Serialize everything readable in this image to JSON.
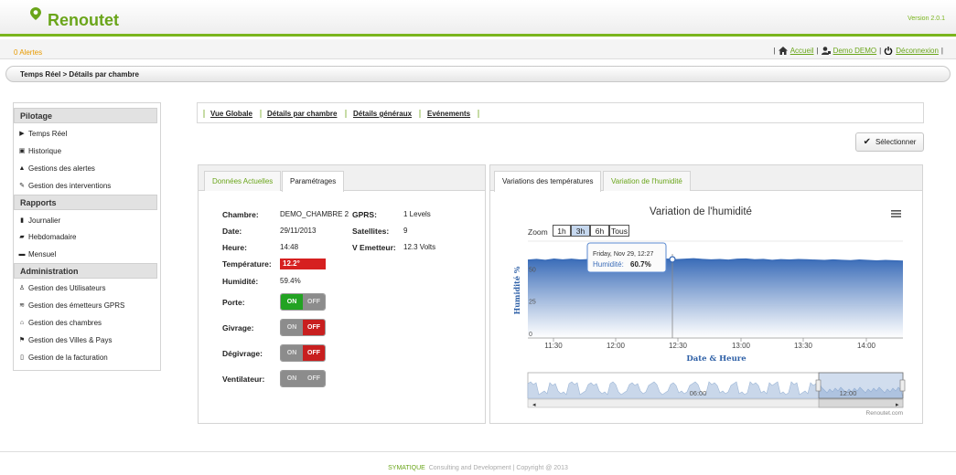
{
  "header": {
    "logo_text": "Renoutet",
    "version": "Version 2.0.1",
    "brand_color": "#7ab51d"
  },
  "alertbar": {
    "alerts": "0 Alertes",
    "nav": {
      "home": "Accueil",
      "user": "Demo DEMO",
      "logout": "Déconnexion"
    }
  },
  "breadcrumb": "Temps Réel > Détails par chambre",
  "sidebar": {
    "sections": [
      {
        "title": "Pilotage",
        "items": [
          {
            "label": "Temps Réel",
            "icon": "play-icon"
          },
          {
            "label": "Historique",
            "icon": "history-icon"
          },
          {
            "label": "Gestions des alertes",
            "icon": "warning-icon"
          },
          {
            "label": "Gestion des interventions",
            "icon": "wrench-icon"
          }
        ]
      },
      {
        "title": "Rapports",
        "items": [
          {
            "label": "Journalier",
            "icon": "document-icon"
          },
          {
            "label": "Hebdomadaire",
            "icon": "folder-open-icon"
          },
          {
            "label": "Mensuel",
            "icon": "folder-icon"
          }
        ]
      },
      {
        "title": "Administration",
        "items": [
          {
            "label": "Gestion des Utilisateurs",
            "icon": "user-icon"
          },
          {
            "label": "Gestion des émetteurs GPRS",
            "icon": "signal-icon"
          },
          {
            "label": "Gestion des chambres",
            "icon": "home-icon"
          },
          {
            "label": "Gestion des Villes & Pays",
            "icon": "flag-icon"
          },
          {
            "label": "Gestion de la facturation",
            "icon": "invoice-icon"
          }
        ]
      }
    ]
  },
  "main_nav": [
    "Vue Globale",
    "Détails par chambre",
    "Détails généraux",
    "Evénements"
  ],
  "select_button": "Sélectionner",
  "left_panel": {
    "tabs": [
      "Données Actuelles",
      "Paramétrages"
    ],
    "active_tab": "Paramétrages",
    "fields": {
      "chambre_label": "Chambre:",
      "chambre": "DEMO_CHAMBRE 2",
      "date_label": "Date:",
      "date": "29/11/2013",
      "heure_label": "Heure:",
      "heure": "14:48",
      "temperature_label": "Température:",
      "temperature": "12.2°",
      "humidite_label": "Humidité:",
      "humidite": "59.4%",
      "gprs_label": "GPRS:",
      "gprs": "1 Levels",
      "satellites_label": "Satellites:",
      "satellites": "9",
      "vemetteur_label": "V Emetteur:",
      "vemetteur": "12.3 Volts"
    },
    "toggles": [
      {
        "label": "Porte:",
        "on": "ON",
        "off": "OFF",
        "state": "on"
      },
      {
        "label": "Givrage:",
        "on": "ON",
        "off": "OFF",
        "state": "off"
      },
      {
        "label": "Dégivrage:",
        "on": "ON",
        "off": "OFF",
        "state": "off"
      },
      {
        "label": "Ventilateur:",
        "on": "ON",
        "off": "OFF",
        "state": "none"
      }
    ]
  },
  "right_panel": {
    "tabs": [
      "Variations des températures",
      "Variation de l'humidité"
    ],
    "active_tab": "Variations des températures"
  },
  "zoom": {
    "label": "Zoom",
    "options": [
      "1h",
      "3h",
      "6h",
      "Tous"
    ],
    "selected": "3h"
  },
  "chart_data": {
    "type": "area",
    "title": "Variation de l'humidité",
    "xlabel": "Date & Heure",
    "ylabel": "Humidité %",
    "x_ticks": [
      "11:30",
      "12:00",
      "12:30",
      "13:00",
      "13:30",
      "14:00"
    ],
    "y_ticks": [
      "0",
      "25",
      "50"
    ],
    "ylim": [
      0,
      75
    ],
    "series": [
      {
        "values": [
          60.2,
          60.8,
          60.1,
          61.0,
          60.4,
          60.9,
          60.3,
          60.7,
          61.2,
          60.5,
          60.9,
          60.6,
          61.1,
          60.7,
          60.8,
          60.3,
          61.0,
          60.6,
          60.9,
          61.3,
          60.8,
          60.4,
          60.7,
          60.2,
          60.9,
          61.1,
          60.5,
          60.8,
          60.1,
          60.6,
          60.3,
          60.7,
          60.5,
          60.2,
          59.9,
          60.4,
          60.1,
          59.8,
          60.3,
          59.9,
          59.6,
          60.0,
          59.7,
          59.4
        ]
      }
    ],
    "tooltip": {
      "date": "Friday, Nov 29, 12:27",
      "label": "Humidité:",
      "value": "60.7%"
    },
    "navigator": {
      "labels": [
        "06:00",
        "12:00"
      ]
    },
    "credits": "Renoutet.com",
    "grid": true
  },
  "footer": {
    "brand": "SYMATIQUE",
    "text": "Consulting and Development | Copyright @ 2013"
  }
}
